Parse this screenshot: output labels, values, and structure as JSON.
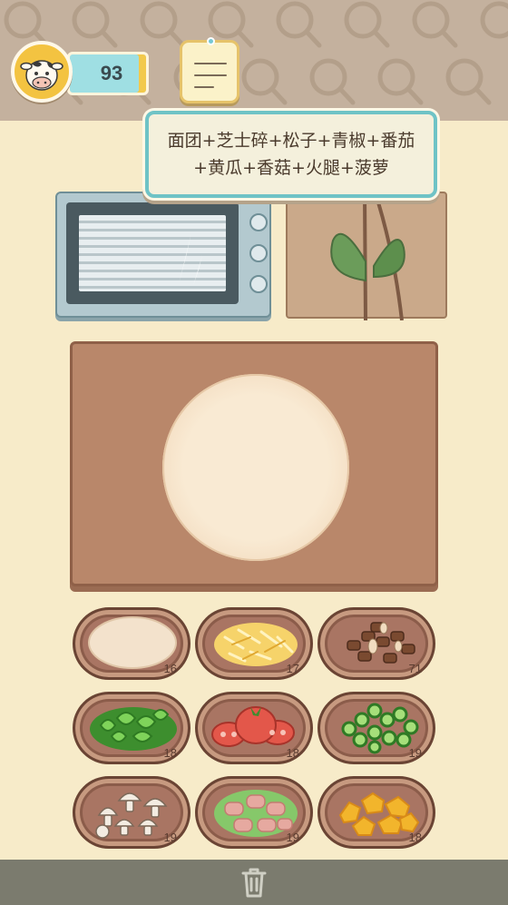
{
  "player": {
    "score": "93",
    "avatar_icon": "cow-icon"
  },
  "order": {
    "button_icon": "order-note-icon",
    "text": "面团+芝士碎+松子+青椒+番茄+黄瓜+香菇+火腿+菠萝"
  },
  "kitchen": {
    "oven_icon": "oven-icon",
    "shelf_icon": "leaf-shelf-icon",
    "board_icon": "cutting-board-icon",
    "dough_icon": "pizza-dough-icon"
  },
  "ingredients": [
    {
      "name": "dough-ball",
      "icon": "dough-ball-icon",
      "count": "16",
      "color": "#f3e2cc"
    },
    {
      "name": "cheese",
      "icon": "shredded-cheese-icon",
      "count": "17",
      "color": "#f6d36a"
    },
    {
      "name": "pine-nuts",
      "icon": "pine-nuts-icon",
      "count": "71",
      "color": "#7a4a30"
    },
    {
      "name": "green-pepper",
      "icon": "green-pepper-icon",
      "count": "18",
      "color": "#6cc04a"
    },
    {
      "name": "tomato",
      "icon": "tomato-icon",
      "count": "18",
      "color": "#e3574a"
    },
    {
      "name": "cucumber",
      "icon": "cucumber-icon",
      "count": "19",
      "color": "#5bb24a"
    },
    {
      "name": "mushroom",
      "icon": "mushroom-icon",
      "count": "19",
      "color": "#ece4d8"
    },
    {
      "name": "ham",
      "icon": "ham-icon",
      "count": "19",
      "color": "#e6a9a0"
    },
    {
      "name": "pineapple",
      "icon": "pineapple-icon",
      "count": "18",
      "color": "#f2b52c"
    }
  ],
  "footer": {
    "trash_icon": "trash-icon"
  }
}
